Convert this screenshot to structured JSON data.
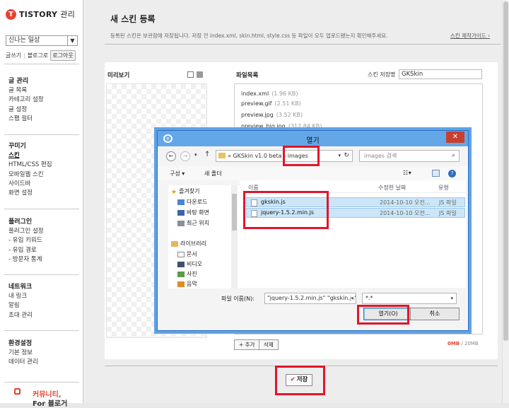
{
  "sidebar": {
    "logo_text": "TISTORY",
    "logo_sub": "관리",
    "blog_select": "신나는 일상",
    "quick": {
      "write": "글쓰기",
      "blog_home": "블로그로",
      "logout": "로그아웃"
    },
    "sections": [
      {
        "title": "글 관리",
        "items": [
          "글 목록",
          "카테고리 설정",
          "글 설정",
          "스팸 필터"
        ]
      },
      {
        "title": "꾸미기",
        "items": [
          "스킨",
          "HTML/CSS 편집",
          "모바일웹 스킨",
          "사이드바",
          "화면 설정"
        ]
      },
      {
        "title": "플러그인",
        "items": [
          "플러그인 설정",
          "- 유입 키워드",
          "- 유입 경로",
          "- 방문자 통계"
        ]
      },
      {
        "title": "네트워크",
        "items": [
          "내 링크",
          "알림",
          "초대 관리"
        ]
      },
      {
        "title": "환경설정",
        "items": [
          "기본 정보",
          "데이터 관리"
        ]
      }
    ],
    "promo": {
      "line1": "커뮤니티,",
      "line2": "For 블로거"
    }
  },
  "main": {
    "title": "새 스킨 등록",
    "description": "등록된 스킨은 보관함에 저장됩니다. 저장 전 index.xml, skin.html, style.css 등 파일이 모두 업로드됐는지 확인해주세요.",
    "guide_link": "스킨 제작가이드 ›",
    "preview_label": "미리보기",
    "files_label": "파일목록",
    "skin_name_label": "스킨 저장명",
    "skin_name_value": "GKSkin",
    "files": [
      {
        "name": "index.xml",
        "size": "(1.96 KB)"
      },
      {
        "name": "preview.gif",
        "size": "(2.51 KB)"
      },
      {
        "name": "preview.jpg",
        "size": "(3.52 KB)"
      },
      {
        "name": "preview_big.jpg",
        "size": "(312.84 KB)"
      }
    ],
    "add_label": "+ 추가",
    "delete_label": "삭제",
    "quota_used": "0MB",
    "quota_total": " / 20MB",
    "save_label": "저장"
  },
  "dialog": {
    "title": "열기",
    "close": "✕",
    "address": {
      "prefix": "«",
      "parent": "GKSkin v1.0 beta",
      "sep": "›",
      "current": "images"
    },
    "search_placeholder": "images 검색",
    "toolbar": {
      "organize": "구성 ▾",
      "new_folder": "새 폴더"
    },
    "nav": [
      {
        "label": "즐겨찾기",
        "type": "star"
      },
      {
        "label": "다운로드",
        "type": "download"
      },
      {
        "label": "바탕 화면",
        "type": "desktop"
      },
      {
        "label": "최근 위치",
        "type": "recent"
      },
      {
        "label": "라이브러리",
        "type": "library"
      },
      {
        "label": "문서",
        "type": "docs"
      },
      {
        "label": "비디오",
        "type": "video"
      },
      {
        "label": "사진",
        "type": "photo"
      },
      {
        "label": "음악",
        "type": "music"
      }
    ],
    "columns": {
      "name": "이름",
      "date": "수정한 날짜",
      "type": "유형"
    },
    "rows": [
      {
        "name": "gkskin.js",
        "date": "2014-10-10 오전...",
        "type": "JS 파일"
      },
      {
        "name": "jquery-1.5.2.min.js",
        "date": "2014-10-10 오전...",
        "type": "JS 파일"
      }
    ],
    "filename_label": "파일 이름(N):",
    "filename_value": "\"jquery-1.5.2.min.js\" \"gkskin.js\"",
    "filetype_value": "*.*",
    "open_label": "열기(O)",
    "cancel_label": "취소"
  }
}
